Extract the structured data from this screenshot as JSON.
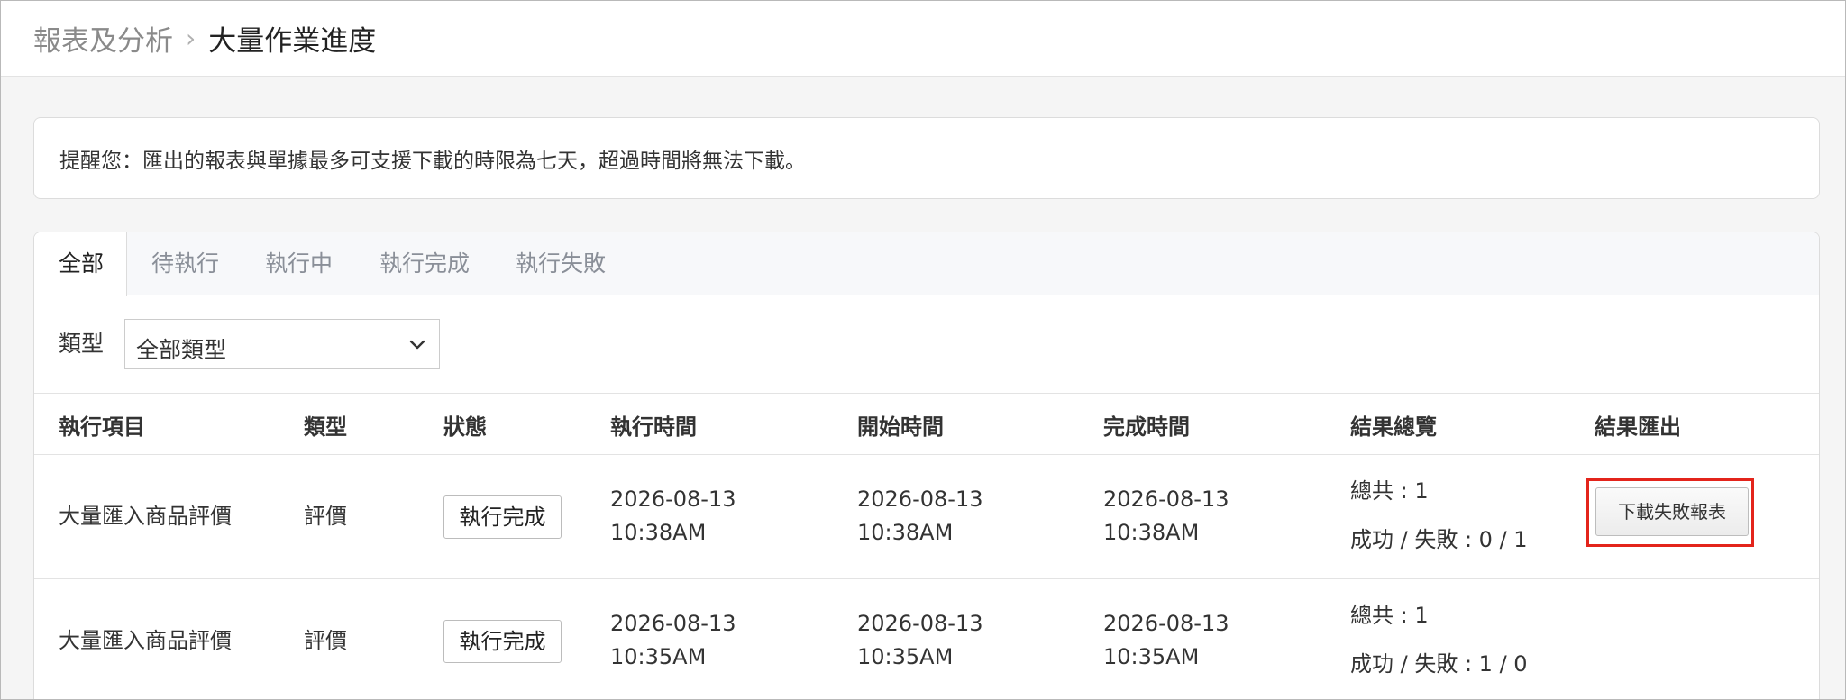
{
  "breadcrumb": {
    "parent": "報表及分析",
    "separator": "›",
    "current": "大量作業進度"
  },
  "notice": {
    "text": "提醒您：匯出的報表與單據最多可支援下載的時限為七天，超過時間將無法下載。"
  },
  "tabs": [
    {
      "label": "全部",
      "active": true
    },
    {
      "label": "待執行",
      "active": false
    },
    {
      "label": "執行中",
      "active": false
    },
    {
      "label": "執行完成",
      "active": false
    },
    {
      "label": "執行失敗",
      "active": false
    }
  ],
  "filter": {
    "label": "類型",
    "selected": "全部類型",
    "icon": "chevron-down-icon"
  },
  "table": {
    "headers": [
      "執行項目",
      "類型",
      "狀態",
      "執行時間",
      "開始時間",
      "完成時間",
      "結果總覽",
      "結果匯出"
    ],
    "rows": [
      {
        "item": "大量匯入商品評價",
        "type": "評價",
        "status": "執行完成",
        "exec_date": "2026-08-13",
        "exec_time": "10:38AM",
        "start_date": "2026-08-13",
        "start_time": "10:38AM",
        "end_date": "2026-08-13",
        "end_time": "10:38AM",
        "total": "總共 : 1",
        "result": "成功 / 失敗 : 0 / 1",
        "export_label": "下載失敗報表"
      },
      {
        "item": "大量匯入商品評價",
        "type": "評價",
        "status": "執行完成",
        "exec_date": "2026-08-13",
        "exec_time": "10:35AM",
        "start_date": "2026-08-13",
        "start_time": "10:35AM",
        "end_date": "2026-08-13",
        "end_time": "10:35AM",
        "total": "總共 : 1",
        "result": "成功 / 失敗 : 1 / 0"
      }
    ]
  },
  "colors": {
    "highlight": "#e3241b",
    "tab_inactive": "#8a8f98",
    "border": "#dcdcdc"
  }
}
